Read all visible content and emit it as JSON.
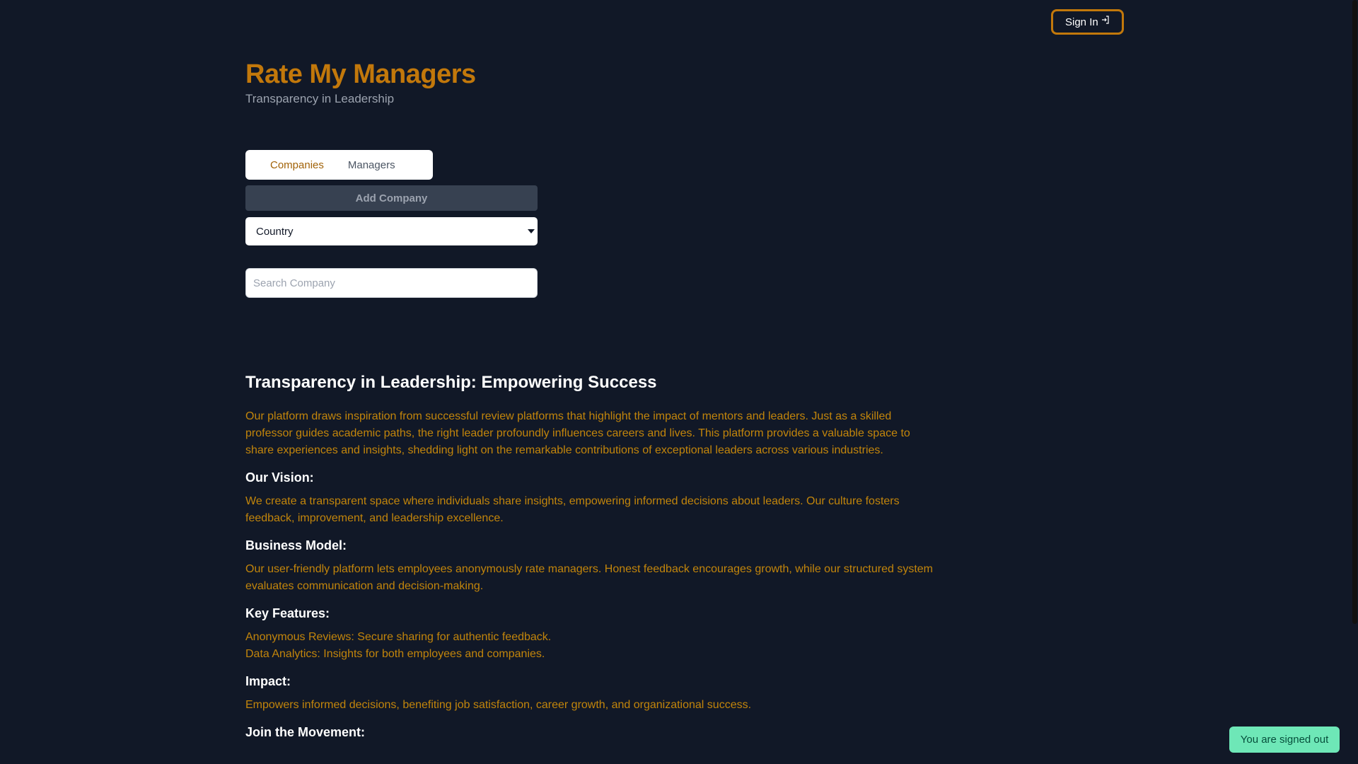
{
  "header": {
    "sign_in_label": "Sign In"
  },
  "brand": {
    "title": "Rate My Managers",
    "subtitle": "Transparency in Leadership"
  },
  "tabs": [
    {
      "label": "Companies"
    },
    {
      "label": "Managers"
    }
  ],
  "controls": {
    "add_company_label": "Add Company",
    "country_select_value": "Country",
    "search_placeholder": "Search Company"
  },
  "content": {
    "heading": "Transparency in Leadership: Empowering Success",
    "intro": "Our platform draws inspiration from successful review platforms that highlight the impact of mentors and leaders. Just as a skilled professor guides academic paths, the right leader profoundly influences careers and lives. This platform provides a valuable space to share experiences and insights, shedding light on the remarkable contributions of exceptional leaders across various industries.",
    "vision_title": "Our Vision:",
    "vision_text": "We create a transparent space where individuals share insights, empowering informed decisions about leaders. Our culture fosters feedback, improvement, and leadership excellence.",
    "business_title": "Business Model:",
    "business_text": "Our user-friendly platform lets employees anonymously rate managers. Honest feedback encourages growth, while our structured system evaluates communication and decision-making.",
    "features_title": "Key Features:",
    "features": [
      "Anonymous Reviews: Secure sharing for authentic feedback.",
      "Data Analytics: Insights for both employees and companies."
    ],
    "impact_title": "Impact:",
    "impact_text": "Empowers informed decisions, benefiting job satisfaction, career growth, and organizational success.",
    "movement_title": "Join the Movement:"
  },
  "toast": {
    "message": "You are signed out"
  },
  "colors": {
    "background": "#111827",
    "accent": "#c2780b",
    "toast": "#6ee7b7"
  }
}
